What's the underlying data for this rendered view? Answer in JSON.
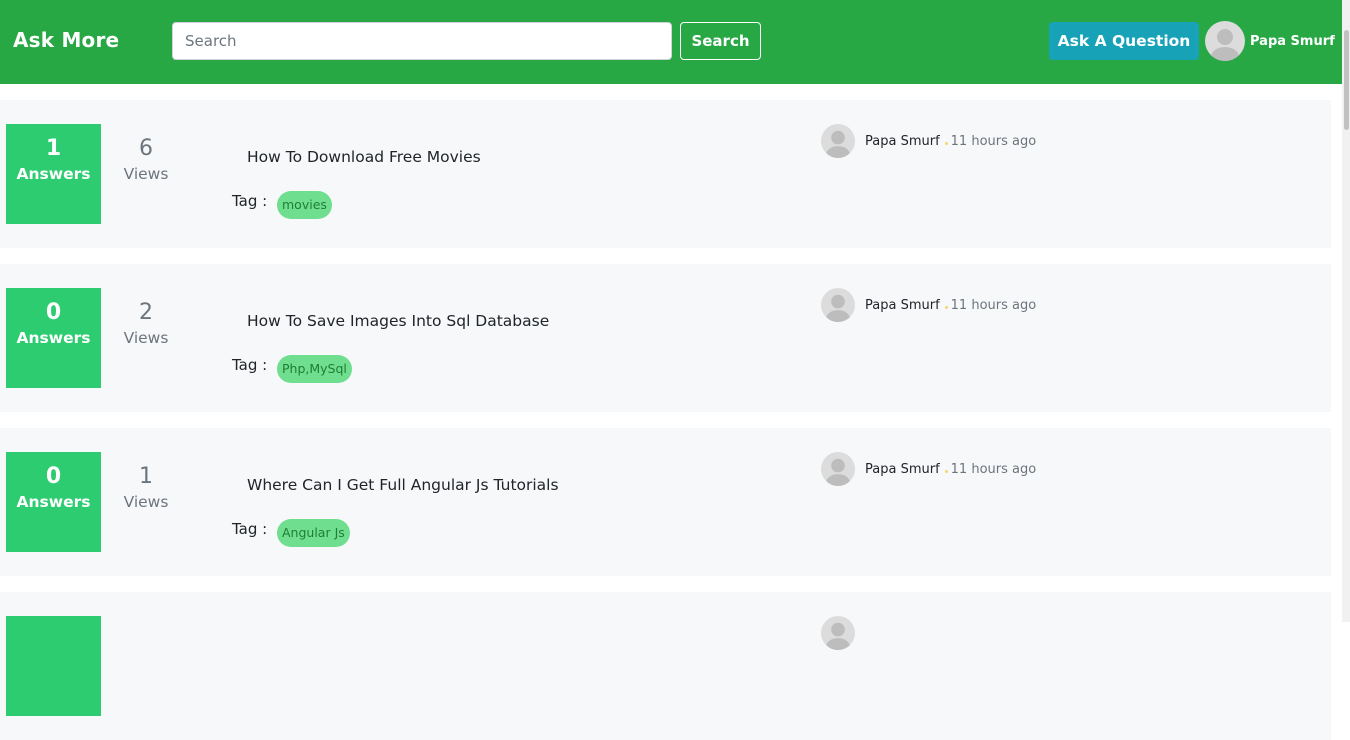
{
  "navbar": {
    "brand": "Ask More",
    "search_placeholder": "Search",
    "search_button": "Search",
    "ask_button": "Ask A Question",
    "username": "Papa Smurf",
    "avatar_icon": "user-avatar-icon"
  },
  "colors": {
    "navbar": "#28a745",
    "answers_box": "#2ecc71",
    "tag": "#6fdf8f",
    "ask_button": "#17a2b8"
  },
  "questions": [
    {
      "answers_count": "1",
      "answers_label": "Answers",
      "views_count": "6",
      "views_label": "Views",
      "title": "How To Download Free Movies",
      "tag_label": "Tag :",
      "tag": "movies",
      "author": "Papa Smurf",
      "time": "11 hours ago"
    },
    {
      "answers_count": "0",
      "answers_label": "Answers",
      "views_count": "2",
      "views_label": "Views",
      "title": "How To Save Images Into Sql Database",
      "tag_label": "Tag :",
      "tag": "Php,MySql",
      "author": "Papa Smurf",
      "time": "11 hours ago"
    },
    {
      "answers_count": "0",
      "answers_label": "Answers",
      "views_count": "1",
      "views_label": "Views",
      "title": "Where Can I Get Full Angular Js Tutorials",
      "tag_label": "Tag :",
      "tag": "Angular Js",
      "author": "Papa Smurf",
      "time": "11 hours ago"
    }
  ]
}
